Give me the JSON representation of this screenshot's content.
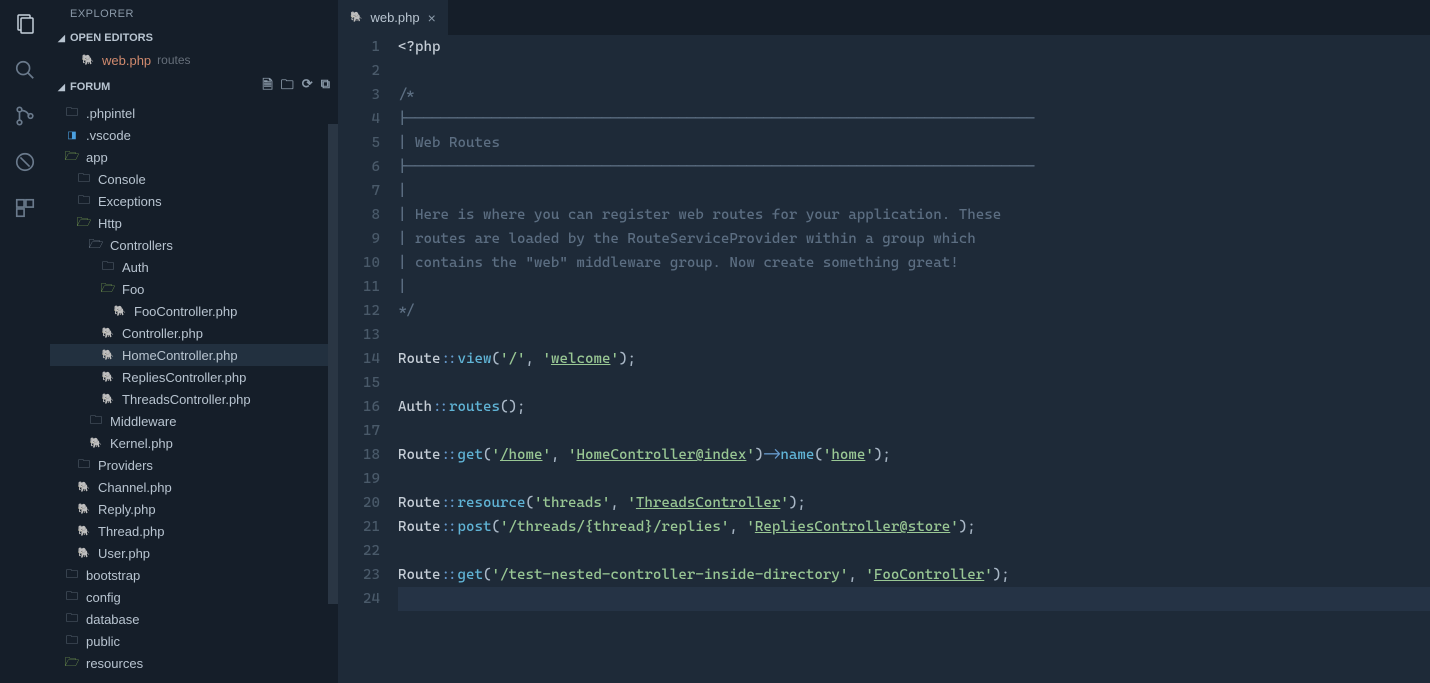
{
  "activity": [
    "files",
    "search",
    "git",
    "debug",
    "extensions"
  ],
  "sidebar": {
    "title": "EXPLORER",
    "openEditorsLabel": "OPEN EDITORS",
    "openEditor": {
      "name": "web.php",
      "hint": "routes"
    },
    "projectLabel": "FORUM",
    "tree": [
      {
        "indent": 0,
        "kind": "folder-closed",
        "label": ".phpintel"
      },
      {
        "indent": 0,
        "kind": "vscode",
        "label": ".vscode"
      },
      {
        "indent": 0,
        "kind": "folder-open-green",
        "label": "app"
      },
      {
        "indent": 1,
        "kind": "folder-closed",
        "label": "Console"
      },
      {
        "indent": 1,
        "kind": "folder-closed",
        "label": "Exceptions"
      },
      {
        "indent": 1,
        "kind": "folder-open-green",
        "label": "Http"
      },
      {
        "indent": 2,
        "kind": "folder-open",
        "label": "Controllers"
      },
      {
        "indent": 3,
        "kind": "folder-closed",
        "label": "Auth"
      },
      {
        "indent": 3,
        "kind": "folder-open-green",
        "label": "Foo"
      },
      {
        "indent": 4,
        "kind": "php",
        "label": "FooController.php"
      },
      {
        "indent": 3,
        "kind": "php",
        "label": "Controller.php"
      },
      {
        "indent": 3,
        "kind": "php",
        "label": "HomeController.php",
        "hovered": true
      },
      {
        "indent": 3,
        "kind": "php",
        "label": "RepliesController.php"
      },
      {
        "indent": 3,
        "kind": "php",
        "label": "ThreadsController.php"
      },
      {
        "indent": 2,
        "kind": "folder-closed",
        "label": "Middleware"
      },
      {
        "indent": 2,
        "kind": "php",
        "label": "Kernel.php"
      },
      {
        "indent": 1,
        "kind": "folder-closed",
        "label": "Providers"
      },
      {
        "indent": 1,
        "kind": "php",
        "label": "Channel.php"
      },
      {
        "indent": 1,
        "kind": "php",
        "label": "Reply.php"
      },
      {
        "indent": 1,
        "kind": "php",
        "label": "Thread.php"
      },
      {
        "indent": 1,
        "kind": "php",
        "label": "User.php"
      },
      {
        "indent": 0,
        "kind": "folder-closed",
        "label": "bootstrap"
      },
      {
        "indent": 0,
        "kind": "folder-closed",
        "label": "config"
      },
      {
        "indent": 0,
        "kind": "folder-closed",
        "label": "database"
      },
      {
        "indent": 0,
        "kind": "folder-closed",
        "label": "public"
      },
      {
        "indent": 0,
        "kind": "folder-open-green",
        "label": "resources"
      }
    ]
  },
  "tab": {
    "label": "web.php"
  },
  "code": {
    "lines": [
      [
        {
          "t": "<?php",
          "c": "c-cls"
        }
      ],
      [],
      [
        {
          "t": "/*",
          "c": "c-comment"
        }
      ],
      [
        {
          "t": "|--------------------------------------------------------------------------",
          "c": "c-comment"
        }
      ],
      [
        {
          "t": "| Web Routes",
          "c": "c-comment"
        }
      ],
      [
        {
          "t": "|--------------------------------------------------------------------------",
          "c": "c-comment"
        }
      ],
      [
        {
          "t": "|",
          "c": "c-comment"
        }
      ],
      [
        {
          "t": "| Here is where you can register web routes for your application. These",
          "c": "c-comment"
        }
      ],
      [
        {
          "t": "| routes are loaded by the RouteServiceProvider within a group which",
          "c": "c-comment"
        }
      ],
      [
        {
          "t": "| contains the \"web\" middleware group. Now create something great!",
          "c": "c-comment"
        }
      ],
      [
        {
          "t": "|",
          "c": "c-comment"
        }
      ],
      [
        {
          "t": "*/",
          "c": "c-comment"
        }
      ],
      [],
      [
        {
          "t": "Route",
          "c": "c-cls"
        },
        {
          "t": "::",
          "c": "c-op"
        },
        {
          "t": "view",
          "c": "c-fn"
        },
        {
          "t": "("
        },
        {
          "t": "'/'",
          "c": "c-str"
        },
        {
          "t": ", "
        },
        {
          "t": "'",
          "c": "c-str"
        },
        {
          "t": "welcome",
          "c": "c-str c-link"
        },
        {
          "t": "'",
          "c": "c-str"
        },
        {
          "t": ");"
        }
      ],
      [],
      [
        {
          "t": "Auth",
          "c": "c-cls"
        },
        {
          "t": "::",
          "c": "c-op"
        },
        {
          "t": "routes",
          "c": "c-fn"
        },
        {
          "t": "();"
        }
      ],
      [],
      [
        {
          "t": "Route",
          "c": "c-cls"
        },
        {
          "t": "::",
          "c": "c-op"
        },
        {
          "t": "get",
          "c": "c-fn"
        },
        {
          "t": "("
        },
        {
          "t": "'",
          "c": "c-str"
        },
        {
          "t": "/home",
          "c": "c-str c-link"
        },
        {
          "t": "'",
          "c": "c-str"
        },
        {
          "t": ", "
        },
        {
          "t": "'",
          "c": "c-str"
        },
        {
          "t": "HomeController@index",
          "c": "c-str c-link"
        },
        {
          "t": "'",
          "c": "c-str"
        },
        {
          "t": ")"
        },
        {
          "t": "->",
          "c": "c-op"
        },
        {
          "t": "name",
          "c": "c-fn"
        },
        {
          "t": "("
        },
        {
          "t": "'",
          "c": "c-str"
        },
        {
          "t": "home",
          "c": "c-str c-link"
        },
        {
          "t": "'",
          "c": "c-str"
        },
        {
          "t": ");"
        }
      ],
      [],
      [
        {
          "t": "Route",
          "c": "c-cls"
        },
        {
          "t": "::",
          "c": "c-op"
        },
        {
          "t": "resource",
          "c": "c-fn"
        },
        {
          "t": "("
        },
        {
          "t": "'threads'",
          "c": "c-str"
        },
        {
          "t": ", "
        },
        {
          "t": "'",
          "c": "c-str"
        },
        {
          "t": "ThreadsController",
          "c": "c-str c-link"
        },
        {
          "t": "'",
          "c": "c-str"
        },
        {
          "t": ");"
        }
      ],
      [
        {
          "t": "Route",
          "c": "c-cls"
        },
        {
          "t": "::",
          "c": "c-op"
        },
        {
          "t": "post",
          "c": "c-fn"
        },
        {
          "t": "("
        },
        {
          "t": "'/threads/{thread}/replies'",
          "c": "c-str"
        },
        {
          "t": ", "
        },
        {
          "t": "'",
          "c": "c-str"
        },
        {
          "t": "RepliesController@store",
          "c": "c-str c-link"
        },
        {
          "t": "'",
          "c": "c-str"
        },
        {
          "t": ");"
        }
      ],
      [],
      [
        {
          "t": "Route",
          "c": "c-cls"
        },
        {
          "t": "::",
          "c": "c-op"
        },
        {
          "t": "get",
          "c": "c-fn"
        },
        {
          "t": "("
        },
        {
          "t": "'/test-nested-controller-inside-directory'",
          "c": "c-str"
        },
        {
          "t": ", "
        },
        {
          "t": "'",
          "c": "c-str"
        },
        {
          "t": "FooController",
          "c": "c-str c-link"
        },
        {
          "t": "'",
          "c": "c-str"
        },
        {
          "t": ");"
        }
      ],
      []
    ],
    "currentLine": 24
  }
}
